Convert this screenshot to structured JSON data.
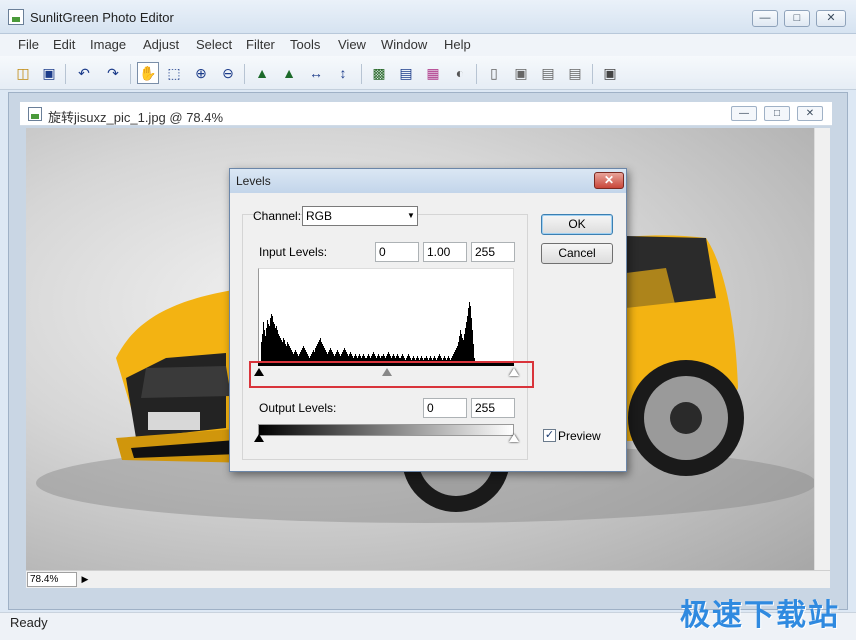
{
  "app": {
    "title": "SunlitGreen Photo Editor"
  },
  "menu": [
    "File",
    "Edit",
    "Image",
    "Adjust",
    "Select",
    "Filter",
    "Tools",
    "View",
    "Window",
    "Help"
  ],
  "toolbar": {
    "icons": [
      "open-folder",
      "save",
      "undo",
      "redo",
      "hand-tool",
      "rect-select",
      "zoom-in",
      "zoom-out",
      "flip-horizontal",
      "flip-vertical",
      "resize-width",
      "resize-height",
      "levels",
      "curves",
      "color-balance",
      "brightness",
      "page-setup",
      "portrait",
      "landscape-a",
      "landscape-b",
      "fullscreen"
    ]
  },
  "document": {
    "title": "旋转jisuxz_pic_1.jpg @ 78.4%",
    "zoom": "78.4%"
  },
  "dialog": {
    "title": "Levels",
    "channel_label": "Channel:",
    "channel_value": "RGB",
    "input_label": "Input Levels:",
    "input_black": "0",
    "input_gamma": "1.00",
    "input_white": "255",
    "output_label": "Output Levels:",
    "output_black": "0",
    "output_white": "255",
    "ok_label": "OK",
    "cancel_label": "Cancel",
    "preview_label": "Preview",
    "preview_checked": true,
    "histogram": [
      0,
      2,
      22,
      30,
      42,
      34,
      28,
      36,
      44,
      40,
      38,
      46,
      50,
      48,
      42,
      40,
      36,
      38,
      34,
      30,
      28,
      26,
      24,
      22,
      26,
      24,
      20,
      18,
      22,
      20,
      18,
      16,
      14,
      12,
      10,
      12,
      14,
      12,
      10,
      8,
      10,
      12,
      14,
      16,
      18,
      16,
      14,
      12,
      10,
      8,
      6,
      8,
      10,
      12,
      14,
      12,
      16,
      18,
      20,
      22,
      24,
      26,
      22,
      20,
      18,
      16,
      14,
      12,
      10,
      12,
      14,
      16,
      14,
      12,
      10,
      8,
      10,
      12,
      14,
      12,
      10,
      8,
      10,
      12,
      14,
      16,
      14,
      12,
      10,
      8,
      10,
      12,
      10,
      8,
      6,
      8,
      10,
      8,
      6,
      8,
      10,
      8,
      6,
      8,
      10,
      8,
      6,
      6,
      8,
      10,
      8,
      6,
      8,
      10,
      12,
      10,
      8,
      6,
      8,
      10,
      8,
      6,
      8,
      8,
      10,
      8,
      6,
      8,
      10,
      12,
      10,
      8,
      6,
      8,
      10,
      8,
      6,
      8,
      10,
      8,
      6,
      6,
      8,
      10,
      8,
      6,
      4,
      6,
      8,
      10,
      8,
      6,
      4,
      6,
      8,
      6,
      4,
      6,
      8,
      6,
      4,
      6,
      8,
      6,
      4,
      6,
      6,
      8,
      6,
      4,
      6,
      8,
      6,
      4,
      6,
      8,
      6,
      4,
      6,
      8,
      10,
      8,
      6,
      4,
      6,
      8,
      6,
      4,
      6,
      8,
      6,
      4,
      6,
      8,
      10,
      12,
      14,
      16,
      18,
      22,
      28,
      34,
      30,
      26,
      24,
      30,
      36,
      42,
      48,
      56,
      62,
      58,
      46,
      34,
      20,
      6,
      2,
      0,
      0,
      0,
      0,
      0,
      0,
      0,
      0,
      0,
      0,
      0,
      0,
      0,
      0,
      0,
      0,
      0,
      0,
      0,
      0,
      0,
      0,
      0,
      0,
      0,
      0,
      0,
      0,
      0,
      0,
      0,
      0,
      0,
      0,
      0,
      0,
      0,
      0,
      0,
      0,
      0,
      0,
      0,
      0,
      0,
      0,
      0,
      0,
      0,
      0,
      0,
      0,
      0
    ],
    "accent_colors": {
      "highlight": "#d9343b",
      "close": "#c9463a"
    }
  },
  "status": {
    "text": "Ready"
  },
  "watermark": {
    "text": "极速下载站"
  }
}
